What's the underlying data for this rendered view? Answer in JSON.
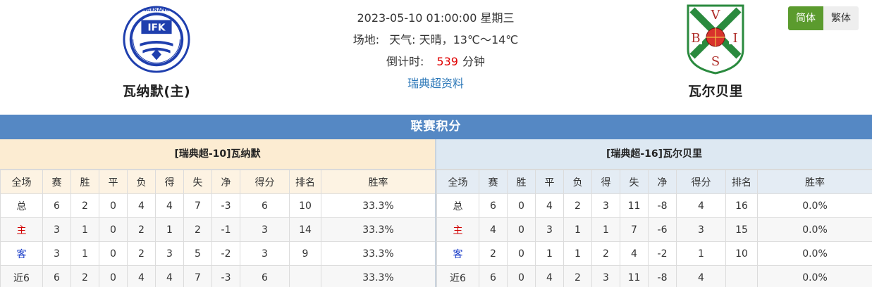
{
  "home_team": {
    "name": "瓦纳默(主)",
    "logo_text": "IFK",
    "logo_ring_text": "VÄRNAMO"
  },
  "away_team": {
    "name": "瓦尔贝里",
    "logo_letters": [
      "V",
      "B",
      "I",
      "S"
    ]
  },
  "match": {
    "datetime": "2023-05-10 01:00:00 星期三",
    "venue_label": "场地:",
    "weather_label": "天气:",
    "weather_value": "天晴，13℃～14℃",
    "countdown_label": "倒计时:",
    "countdown_value": "539",
    "countdown_unit": "分钟",
    "league_link": "瑞典超资料"
  },
  "lang": {
    "simplified": "简体",
    "traditional": "繁体"
  },
  "colors": {
    "section_bg": "#5588c4",
    "home_panel": "#fcecd2",
    "away_panel": "#dde8f2",
    "accent_green": "#5b9b2e",
    "countdown_red": "#e00000"
  },
  "standings": {
    "title": "联赛积分",
    "columns": [
      "全场",
      "赛",
      "胜",
      "平",
      "负",
      "得",
      "失",
      "净",
      "得分",
      "排名",
      "胜率"
    ],
    "home": {
      "title": "[瑞典超-10]瓦纳默",
      "rows": [
        [
          "总",
          "6",
          "2",
          "0",
          "4",
          "4",
          "7",
          "-3",
          "6",
          "10",
          "33.3%"
        ],
        [
          "主",
          "3",
          "1",
          "0",
          "2",
          "1",
          "2",
          "-1",
          "3",
          "14",
          "33.3%"
        ],
        [
          "客",
          "3",
          "1",
          "0",
          "2",
          "3",
          "5",
          "-2",
          "3",
          "9",
          "33.3%"
        ],
        [
          "近6",
          "6",
          "2",
          "0",
          "4",
          "4",
          "7",
          "-3",
          "6",
          "",
          "33.3%"
        ]
      ]
    },
    "away": {
      "title": "[瑞典超-16]瓦尔贝里",
      "rows": [
        [
          "总",
          "6",
          "0",
          "4",
          "2",
          "3",
          "11",
          "-8",
          "4",
          "16",
          "0.0%"
        ],
        [
          "主",
          "4",
          "0",
          "3",
          "1",
          "1",
          "7",
          "-6",
          "3",
          "15",
          "0.0%"
        ],
        [
          "客",
          "2",
          "0",
          "1",
          "1",
          "2",
          "4",
          "-2",
          "1",
          "10",
          "0.0%"
        ],
        [
          "近6",
          "6",
          "0",
          "4",
          "2",
          "3",
          "11",
          "-8",
          "4",
          "",
          "0.0%"
        ]
      ]
    }
  }
}
